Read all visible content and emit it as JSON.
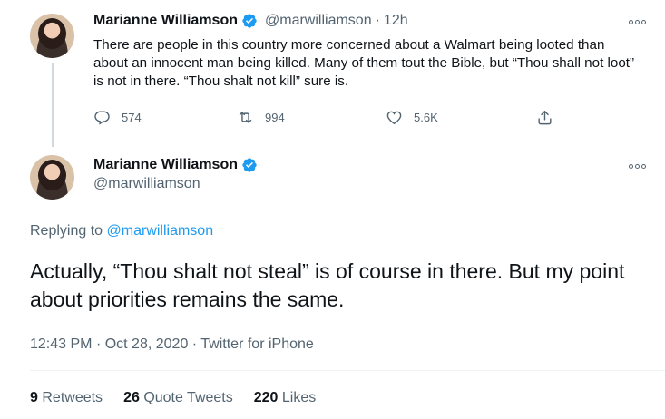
{
  "tweet1": {
    "author": "Marianne Williamson",
    "handle": "@marwilliamson",
    "dot": "·",
    "time": "12h",
    "text": "There are people in this country more concerned about a Walmart being looted than about an innocent man being killed. Many of them tout the Bible, but “Thou shall not loot” is not in there. “Thou shalt not kill” sure is.",
    "replies": "574",
    "retweets": "994",
    "likes": "5.6K"
  },
  "tweet2": {
    "author": "Marianne Williamson",
    "handle": "@marwilliamson",
    "replying_prefix": "Replying to",
    "replying_to": "@marwilliamson",
    "text": "Actually, “Thou shalt not steal” is of course in there. But my point about priorities remains the same.",
    "time": "12:43 PM",
    "date": "Oct 28, 2020",
    "source": "Twitter for iPhone",
    "sep": "·",
    "retweets_count": "9",
    "retweets_label": "Retweets",
    "quotes_count": "26",
    "quotes_label": "Quote Tweets",
    "likes_count": "220",
    "likes_label": "Likes"
  },
  "colors": {
    "accent": "#1d9bf0",
    "secondary_text": "#536471",
    "primary_text": "#0f1419"
  },
  "icons": [
    "verified-badge-icon",
    "more-icon",
    "reply-icon",
    "retweet-icon",
    "like-icon",
    "share-icon"
  ]
}
